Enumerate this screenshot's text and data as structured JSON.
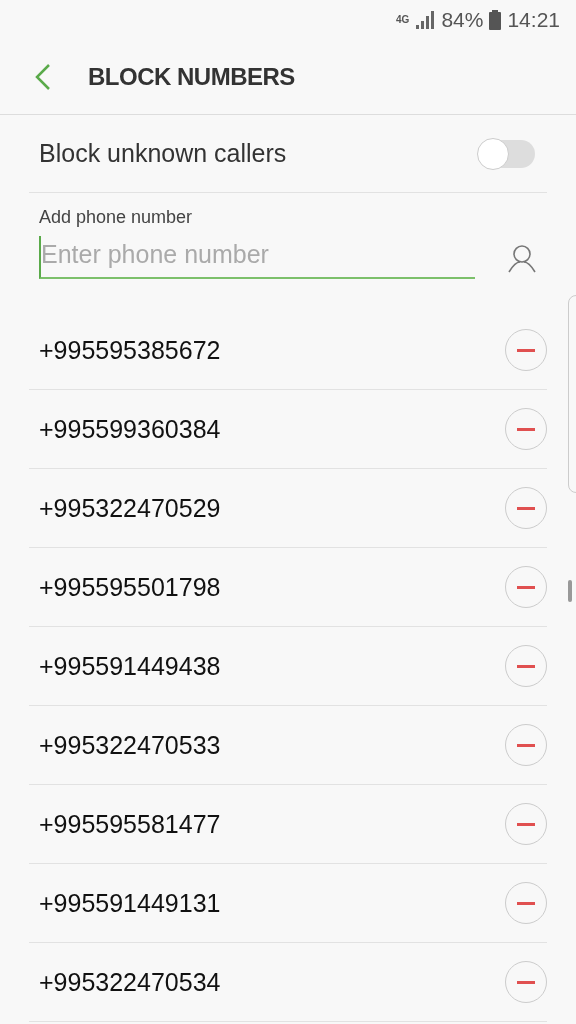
{
  "status_bar": {
    "network": "4G",
    "battery": "84%",
    "time": "14:21"
  },
  "header": {
    "title": "BLOCK NUMBERS"
  },
  "block_unknown": {
    "label": "Block unknown callers",
    "on": false
  },
  "add_number": {
    "label": "Add phone number",
    "placeholder": "Enter phone number"
  },
  "blocked_numbers": [
    {
      "number": "+995595385672"
    },
    {
      "number": "+995599360384"
    },
    {
      "number": "+995322470529"
    },
    {
      "number": "+995595501798"
    },
    {
      "number": "+995591449438"
    },
    {
      "number": "+995322470533"
    },
    {
      "number": "+995595581477"
    },
    {
      "number": "+995591449131"
    },
    {
      "number": "+995322470534"
    }
  ]
}
